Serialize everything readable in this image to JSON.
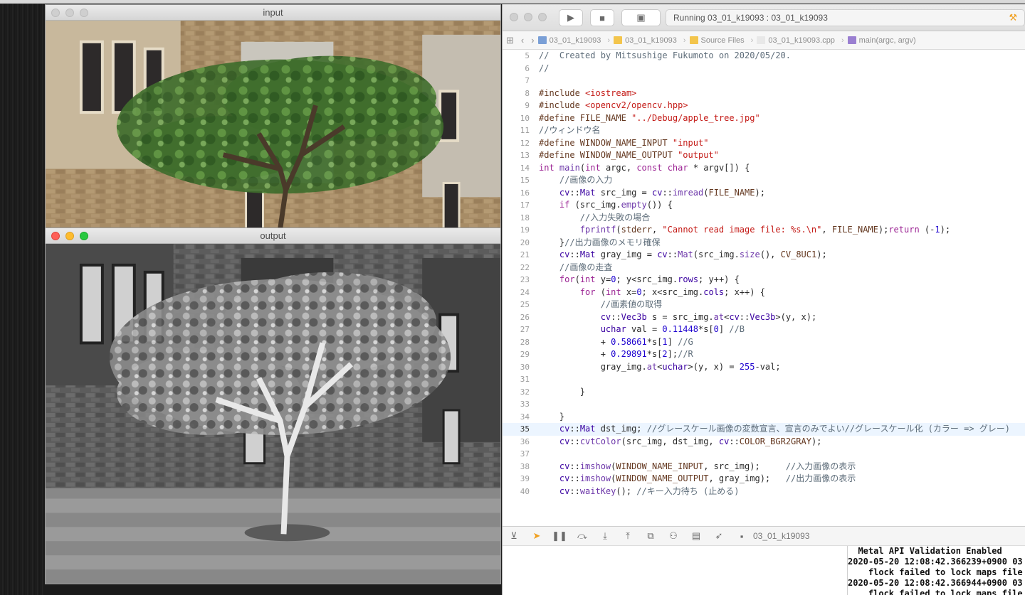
{
  "input_window": {
    "title": "input"
  },
  "output_window": {
    "title": "output"
  },
  "xcode": {
    "scheme_button": "▣",
    "activity_text": "Running 03_01_k19093 : 03_01_k19093",
    "jumpbar": [
      {
        "label": "03_01_k19093",
        "icon": "project-icon",
        "color": "#7a9fd6"
      },
      {
        "label": "03_01_k19093",
        "icon": "folder-icon",
        "color": "#f3c54c"
      },
      {
        "label": "Source Files",
        "icon": "folder-icon",
        "color": "#f3c54c"
      },
      {
        "label": "03_01_k19093.cpp",
        "icon": "cpp-file-icon",
        "color": "#e8e8e8"
      },
      {
        "label": "main(argc, argv)",
        "icon": "function-icon",
        "color": "#9a7fd1"
      }
    ],
    "debug_target": "03_01_k19093",
    "code_lines": [
      {
        "n": "5",
        "cur": false,
        "html": "<span class='c-cm'>//  Created by Mitsushige Fukumoto on 2020/05/20.</span>"
      },
      {
        "n": "6",
        "cur": false,
        "html": "<span class='c-cm'>//</span>"
      },
      {
        "n": "7",
        "cur": false,
        "html": ""
      },
      {
        "n": "8",
        "cur": false,
        "html": "<span class='c-pp'>#include </span><span class='c-str'>&lt;iostream&gt;</span>"
      },
      {
        "n": "9",
        "cur": false,
        "html": "<span class='c-pp'>#include </span><span class='c-str'>&lt;opencv2/opencv.hpp&gt;</span>"
      },
      {
        "n": "10",
        "cur": false,
        "html": "<span class='c-pp'>#define FILE_NAME </span><span class='c-str'>\"../Debug/apple_tree.jpg\"</span>"
      },
      {
        "n": "11",
        "cur": false,
        "html": "<span class='c-cm'>//ウィンドウ名</span>"
      },
      {
        "n": "12",
        "cur": false,
        "html": "<span class='c-pp'>#define WINDOW_NAME_INPUT </span><span class='c-str'>\"input\"</span>"
      },
      {
        "n": "13",
        "cur": false,
        "html": "<span class='c-pp'>#define WINDOW_NAME_OUTPUT </span><span class='c-str'>\"output\"</span>"
      },
      {
        "n": "14",
        "cur": false,
        "html": "<span class='c-kw'>int</span> <span class='c-fn'>main</span>(<span class='c-kw'>int</span> argc, <span class='c-kw'>const</span> <span class='c-kw'>char</span> * argv[]) {"
      },
      {
        "n": "15",
        "cur": false,
        "html": "    <span class='c-cm'>//画像の入力</span>"
      },
      {
        "n": "16",
        "cur": false,
        "html": "    <span class='c-ty'>cv</span>::<span class='c-ty'>Mat</span> src_img = <span class='c-ty'>cv</span>::<span class='c-fn'>imread</span>(<span class='c-mac'>FILE_NAME</span>);"
      },
      {
        "n": "17",
        "cur": false,
        "html": "    <span class='c-kw'>if</span> (src_img.<span class='c-fn'>empty</span>()) {"
      },
      {
        "n": "18",
        "cur": false,
        "html": "        <span class='c-cm'>//入力失敗の場合</span>"
      },
      {
        "n": "19",
        "cur": false,
        "html": "        <span class='c-fn'>fprintf</span>(<span class='c-mac'>stderr</span>, <span class='c-str'>\"Cannot read image file: %s.\\n\"</span>, <span class='c-mac'>FILE_NAME</span>);<span class='c-kw'>return</span> (-<span class='c-num'>1</span>);"
      },
      {
        "n": "20",
        "cur": false,
        "html": "    }<span class='c-cm'>//出力画像のメモリ確保</span>"
      },
      {
        "n": "21",
        "cur": false,
        "html": "    <span class='c-ty'>cv</span>::<span class='c-ty'>Mat</span> gray_img = <span class='c-ty'>cv</span>::<span class='c-fn'>Mat</span>(src_img.<span class='c-fn'>size</span>(), <span class='c-mac'>CV_8UC1</span>);"
      },
      {
        "n": "22",
        "cur": false,
        "html": "    <span class='c-cm'>//画像の走査</span>"
      },
      {
        "n": "23",
        "cur": false,
        "html": "    <span class='c-kw'>for</span>(<span class='c-kw'>int</span> y=<span class='c-num'>0</span>; y&lt;src_img.<span class='c-ty'>rows</span>; y++) {"
      },
      {
        "n": "24",
        "cur": false,
        "html": "        <span class='c-kw'>for</span> (<span class='c-kw'>int</span> x=<span class='c-num'>0</span>; x&lt;src_img.<span class='c-ty'>cols</span>; x++) {"
      },
      {
        "n": "25",
        "cur": false,
        "html": "            <span class='c-cm'>//画素値の取得</span>"
      },
      {
        "n": "26",
        "cur": false,
        "html": "            <span class='c-ty'>cv</span>::<span class='c-ty'>Vec3b</span> s = src_img.<span class='c-fn'>at</span>&lt;<span class='c-ty'>cv</span>::<span class='c-ty'>Vec3b</span>&gt;(y, x);"
      },
      {
        "n": "27",
        "cur": false,
        "html": "            <span class='c-ty'>uchar</span> val = <span class='c-num'>0.11448</span>*s[<span class='c-num'>0</span>] <span class='c-cm'>//B</span>"
      },
      {
        "n": "28",
        "cur": false,
        "html": "            + <span class='c-num'>0.58661</span>*s[<span class='c-num'>1</span>] <span class='c-cm'>//G</span>"
      },
      {
        "n": "29",
        "cur": false,
        "html": "            + <span class='c-num'>0.29891</span>*s[<span class='c-num'>2</span>];<span class='c-cm'>//R</span>"
      },
      {
        "n": "30",
        "cur": false,
        "html": "            gray_img.<span class='c-fn'>at</span>&lt;<span class='c-ty'>uchar</span>&gt;(y, x) = <span class='c-num'>255</span>-val;"
      },
      {
        "n": "31",
        "cur": false,
        "html": ""
      },
      {
        "n": "32",
        "cur": false,
        "html": "        }"
      },
      {
        "n": "33",
        "cur": false,
        "html": ""
      },
      {
        "n": "34",
        "cur": false,
        "html": "    }"
      },
      {
        "n": "35",
        "cur": true,
        "html": "    <span class='c-ty'>cv</span>::<span class='c-ty'>Mat</span> dst_img; <span class='c-cm'>//グレースケール画像の変数宣言、宣言のみでよい//グレースケール化 (カラー => グレー)</span>"
      },
      {
        "n": "36",
        "cur": false,
        "html": "    <span class='c-ty'>cv</span>::<span class='c-fn'>cvtColor</span>(src_img, dst_img, <span class='c-ty'>cv</span>::<span class='c-mac'>COLOR_BGR2GRAY</span>);"
      },
      {
        "n": "37",
        "cur": false,
        "html": ""
      },
      {
        "n": "38",
        "cur": false,
        "html": "    <span class='c-ty'>cv</span>::<span class='c-fn'>imshow</span>(<span class='c-mac'>WINDOW_NAME_INPUT</span>, src_img);     <span class='c-cm'>//入力画像の表示</span>"
      },
      {
        "n": "39",
        "cur": false,
        "html": "    <span class='c-ty'>cv</span>::<span class='c-fn'>imshow</span>(<span class='c-mac'>WINDOW_NAME_OUTPUT</span>, gray_img);   <span class='c-cm'>//出力画像の表示</span>"
      },
      {
        "n": "40",
        "cur": false,
        "html": "    <span class='c-ty'>cv</span>::<span class='c-fn'>waitKey</span>(); <span class='c-cm'>//キー入力待ち (止める)</span>"
      }
    ],
    "console_lines": [
      "  Metal API Validation Enabled",
      "2020-05-20 12:08:42.366239+0900 03",
      "    flock failed to lock maps file",
      "2020-05-20 12:08:42.366944+0900 03",
      "    flock failed to lock maps file"
    ]
  }
}
